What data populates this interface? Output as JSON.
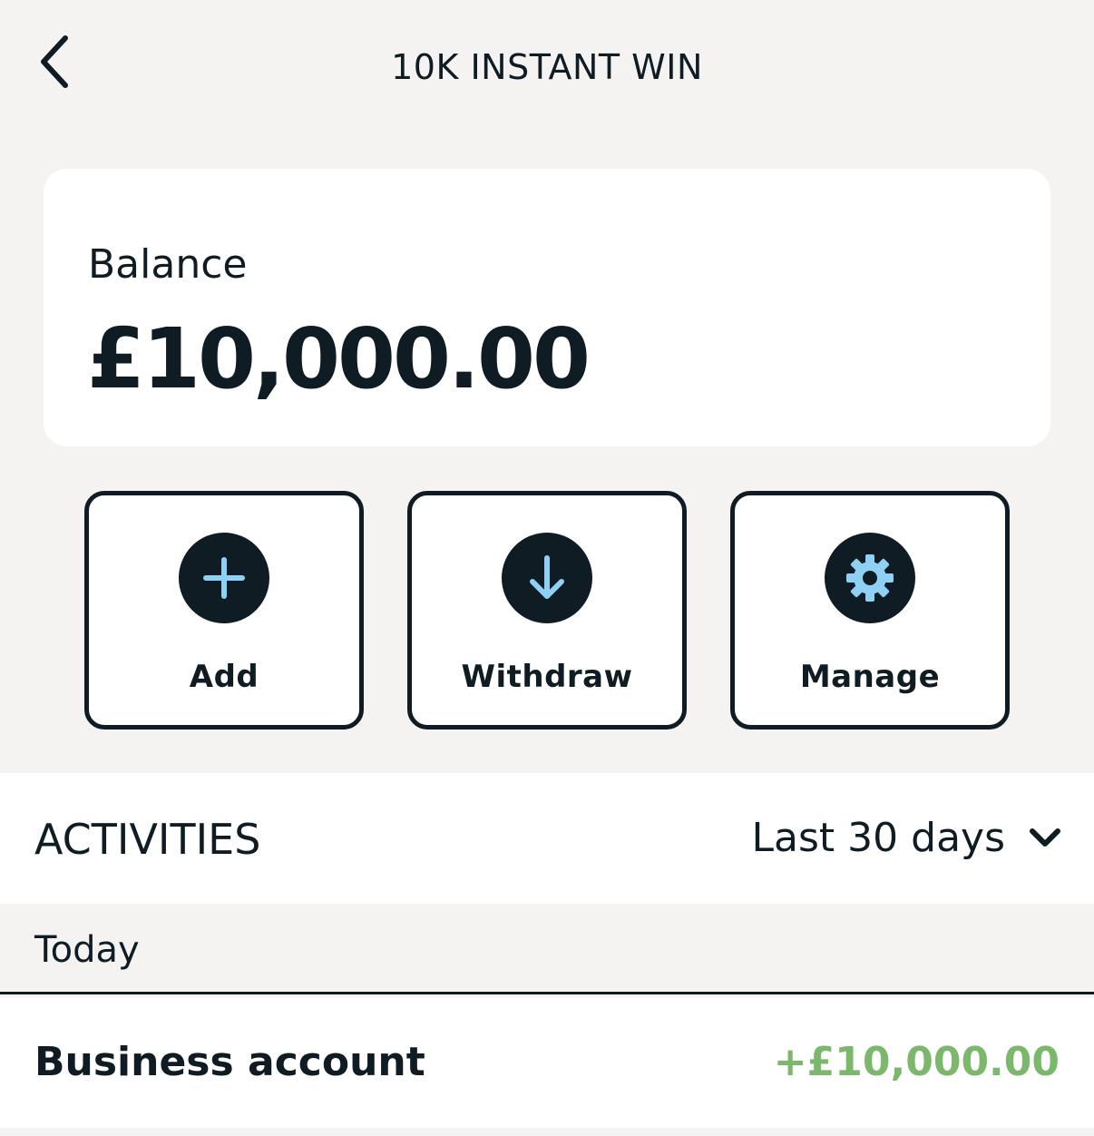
{
  "header": {
    "title": "10K INSTANT WIN",
    "back_icon": "chevron-left-icon"
  },
  "balance": {
    "label": "Balance",
    "amount": "£10,000.00"
  },
  "actions": [
    {
      "label": "Add",
      "icon": "plus-icon"
    },
    {
      "label": "Withdraw",
      "icon": "arrow-down-icon"
    },
    {
      "label": "Manage",
      "icon": "gear-icon"
    }
  ],
  "activities": {
    "title": "ACTIVITIES",
    "range": "Last 30 days",
    "range_icon": "chevron-down-icon",
    "groups": [
      {
        "day": "Today",
        "items": [
          {
            "name": "Business account",
            "amount": "+£10,000.00"
          }
        ]
      }
    ]
  },
  "colors": {
    "ink": "#0f1c24",
    "background": "#f4f3f2",
    "card": "#ffffff",
    "icon_accent": "#8fd0f5",
    "positive": "#7cb86b"
  }
}
